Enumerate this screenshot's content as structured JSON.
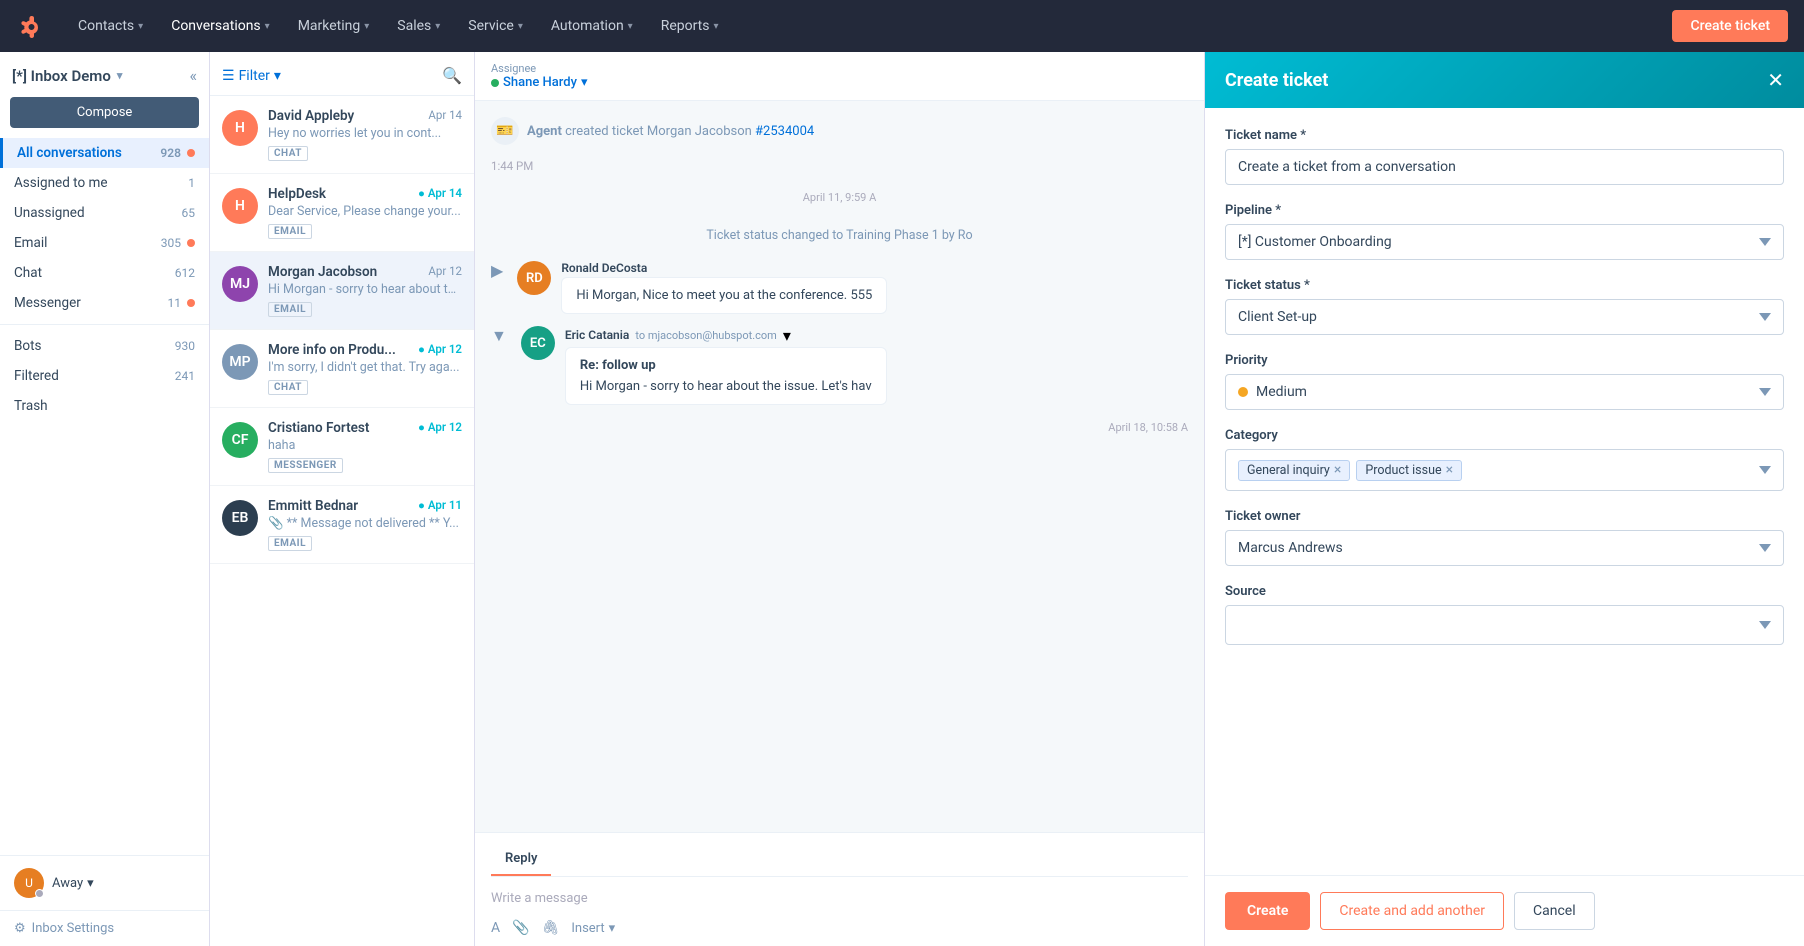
{
  "nav": {
    "logo": "H",
    "items": [
      {
        "label": "Contacts",
        "id": "contacts"
      },
      {
        "label": "Conversations",
        "id": "conversations"
      },
      {
        "label": "Marketing",
        "id": "marketing"
      },
      {
        "label": "Sales",
        "id": "sales"
      },
      {
        "label": "Service",
        "id": "service"
      },
      {
        "label": "Automation",
        "id": "automation"
      },
      {
        "label": "Reports",
        "id": "reports"
      }
    ],
    "create_ticket_btn": "Create ticket"
  },
  "sidebar": {
    "inbox_title": "[*] Inbox Demo",
    "compose_btn": "Compose",
    "nav_items": [
      {
        "label": "All conversations",
        "count": "928",
        "has_dot": true,
        "active": true
      },
      {
        "label": "Assigned to me",
        "count": "1",
        "has_dot": false,
        "active": false
      },
      {
        "label": "Unassigned",
        "count": "65",
        "has_dot": false,
        "active": false
      },
      {
        "label": "Email",
        "count": "305",
        "has_dot": true,
        "active": false
      },
      {
        "label": "Chat",
        "count": "612",
        "has_dot": false,
        "active": false
      },
      {
        "label": "Messenger",
        "count": "11",
        "has_dot": true,
        "active": false
      }
    ],
    "extra_items": [
      {
        "label": "Bots",
        "count": "930"
      },
      {
        "label": "Filtered",
        "count": "241"
      },
      {
        "label": "Trash",
        "count": ""
      }
    ],
    "user_status": "Away",
    "settings_label": "Inbox Settings"
  },
  "conv_list": {
    "filter_label": "Filter",
    "conversations": [
      {
        "name": "David Appleby",
        "date": "Apr 14",
        "date_new": false,
        "preview": "Hey no worries let you in cont...",
        "tag": "CHAT",
        "avatar_color": "#ff7a59",
        "avatar_initials": "H"
      },
      {
        "name": "HelpDesk",
        "date": "Apr 14",
        "date_new": true,
        "preview": "Dear Service, Please change your...",
        "tag": "EMAIL",
        "avatar_color": "#ff7a59",
        "avatar_initials": "H"
      },
      {
        "name": "Morgan Jacobson",
        "date": "Apr 12",
        "date_new": false,
        "preview": "Hi Morgan - sorry to hear about th...",
        "tag": "EMAIL",
        "avatar_color": "#8e44ad",
        "avatar_initials": "MJ"
      },
      {
        "name": "More info on Produ...",
        "date": "Apr 12",
        "date_new": true,
        "preview": "I'm sorry, I didn't get that. Try aga...",
        "tag": "CHAT",
        "avatar_color": "#7c98b6",
        "avatar_initials": "MP"
      },
      {
        "name": "Cristiano Fortest",
        "date": "Apr 12",
        "date_new": true,
        "preview": "haha",
        "tag": "MESSENGER",
        "avatar_color": "#27ae60",
        "avatar_initials": "CF"
      },
      {
        "name": "Emmitt Bednar",
        "date": "Apr 11",
        "date_new": true,
        "preview": "** Message not delivered ** Y...",
        "tag": "EMAIL",
        "avatar_color": "#2c3e50",
        "avatar_initials": "EB"
      }
    ]
  },
  "chat": {
    "assignee_label": "Assignee",
    "assignee_name": "Shane Hardy",
    "messages": [
      {
        "type": "system",
        "text": "Agent created ticket Morgan Jacobson ",
        "ticket_link": "#2534004",
        "time": "1:44 PM"
      },
      {
        "type": "status",
        "text": "Ticket status changed to Training Phase 1 by Ro",
        "date": "April 11, 9:59 A"
      },
      {
        "type": "user",
        "sender": "Ronald DeCosta",
        "preview": "Hi Morgan, Nice to meet you at the conference. 555",
        "avatar_color": "#e67e22",
        "avatar_initials": "RD"
      },
      {
        "type": "email",
        "sender": "Eric Catania",
        "to": "to mjacobson@hubspot.com",
        "subject": "Re: follow up",
        "preview": "Hi Morgan - sorry to hear about the issue. Let's hav",
        "avatar_color": "#16a085",
        "avatar_initials": "EC"
      }
    ],
    "date_divider": "April 18, 10:58 A",
    "reply_tab": "Reply",
    "reply_placeholder": "Write a message",
    "insert_btn": "Insert"
  },
  "create_ticket": {
    "title": "Create ticket",
    "close_icon": "✕",
    "fields": {
      "ticket_name_label": "Ticket name *",
      "ticket_name_value": "Create a ticket from a conversation",
      "pipeline_label": "Pipeline *",
      "pipeline_value": "[*] Customer Onboarding",
      "status_label": "Ticket status *",
      "status_value": "Client Set-up",
      "priority_label": "Priority",
      "priority_value": "Medium",
      "category_label": "Category",
      "category_tags": [
        "General inquiry",
        "Product issue"
      ],
      "owner_label": "Ticket owner",
      "owner_value": "Marcus Andrews",
      "source_label": "Source"
    },
    "buttons": {
      "create": "Create",
      "create_another": "Create and add another",
      "cancel": "Cancel"
    }
  }
}
